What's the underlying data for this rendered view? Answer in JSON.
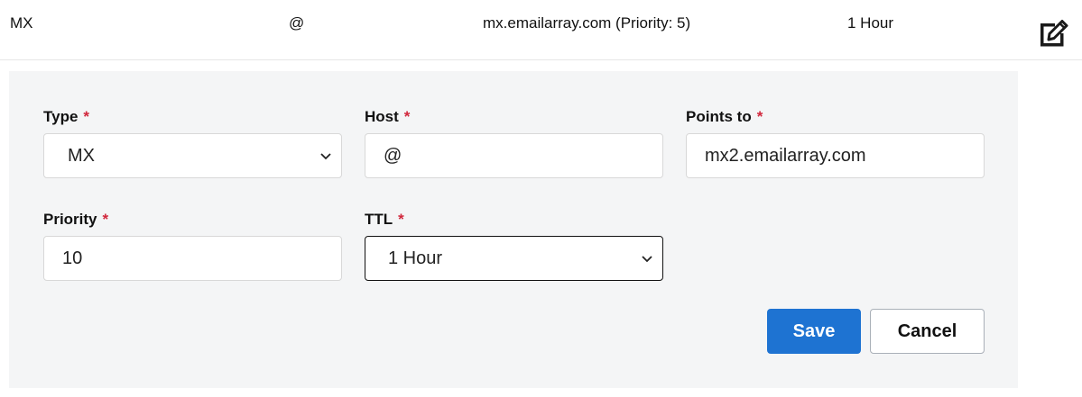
{
  "record": {
    "type": "MX",
    "host": "@",
    "value": "mx.emailarray.com (Priority: 5)",
    "ttl": "1 Hour"
  },
  "form": {
    "type": {
      "label": "Type",
      "required_mark": "*",
      "value": "MX"
    },
    "host": {
      "label": "Host",
      "required_mark": "*",
      "value": "@"
    },
    "points_to": {
      "label": "Points to",
      "required_mark": "*",
      "value": "mx2.emailarray.com"
    },
    "priority": {
      "label": "Priority",
      "required_mark": "*",
      "value": "10"
    },
    "ttl": {
      "label": "TTL",
      "required_mark": "*",
      "value": "1 Hour"
    }
  },
  "actions": {
    "save_label": "Save",
    "cancel_label": "Cancel"
  },
  "colors": {
    "primary": "#1e73d2",
    "required": "#d1263b",
    "panel_bg": "#f4f5f6"
  },
  "icons": {
    "edit": "edit-icon",
    "chevron": "chevron-down-icon"
  }
}
